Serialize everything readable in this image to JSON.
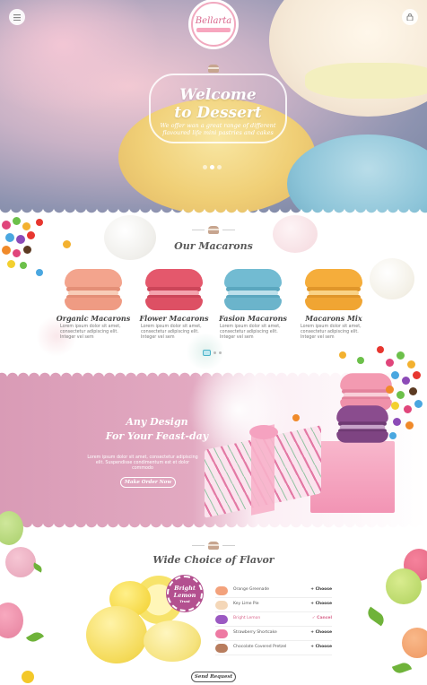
{
  "header": {
    "logo_text": "Bellarta",
    "hero_title_line1": "Welcome",
    "hero_title_line2": "to Dessert",
    "hero_subtitle": "We offer wan a great range of different flavoured life mini pastries and cakes",
    "slider_dots": 3,
    "active_dot": 1
  },
  "macarons_section": {
    "title": "Our Macarons",
    "products": [
      {
        "name": "Organic Macarons",
        "desc": "Lorem ipsum dolor sit amet, consectetur adipiscing elit. Integer vel sem",
        "color_top": "#f1a08a",
        "color_fill": "#f7c8b3"
      },
      {
        "name": "Flower Macarons",
        "desc": "Lorem ipsum dolor sit amet, consectetur adipiscing elit. Integer vel sem",
        "color_top": "#e45a6d",
        "color_fill": "#f19aa6"
      },
      {
        "name": "Fasion Macarons",
        "desc": "Lorem ipsum dolor sit amet, consectetur adipiscing elit. Integer vel sem",
        "color_top": "#6fb9d1",
        "color_fill": "#b6dce8"
      },
      {
        "name": "Macarons Mix",
        "desc": "Lorem ipsum dolor sit amet, consectetur adipiscing elit. Integer vel sem",
        "color_top": "#f3a836",
        "color_fill": "#f8cf7c"
      }
    ]
  },
  "promo": {
    "title_line1": "Any Design",
    "title_line2": "For Your Feast-day",
    "text": "Lorem ipsum dolor sit amet, consectetur adipiscing elit. Suspendisse condimentum est et dolor commodo",
    "button": "Make Order Now"
  },
  "flavor_section": {
    "title": "Wide Choice of Flavor",
    "badge_line1": "Bright",
    "badge_line2": "Lemon",
    "badge_line3": "Trust",
    "items": [
      {
        "name": "Orange Greenade",
        "action": "+ Choose",
        "color": "#f3a27c",
        "active": false
      },
      {
        "name": "Key Lime Pie",
        "action": "+ Choose",
        "color": "#f4d7b8",
        "active": false
      },
      {
        "name": "Bright Lemon",
        "action": "✓ Cancel",
        "color": "#9b59c2",
        "active": true
      },
      {
        "name": "Strawberry Shortcake",
        "action": "+ Choose",
        "color": "#ee7aa3",
        "active": false
      },
      {
        "name": "Chocolate Covered Pretzel",
        "action": "+ Choose",
        "color": "#b87d5e",
        "active": false
      }
    ],
    "button": "Send Request"
  },
  "colors": {
    "accent": "#d9688d",
    "promo_pink": "#e2a9c1"
  }
}
